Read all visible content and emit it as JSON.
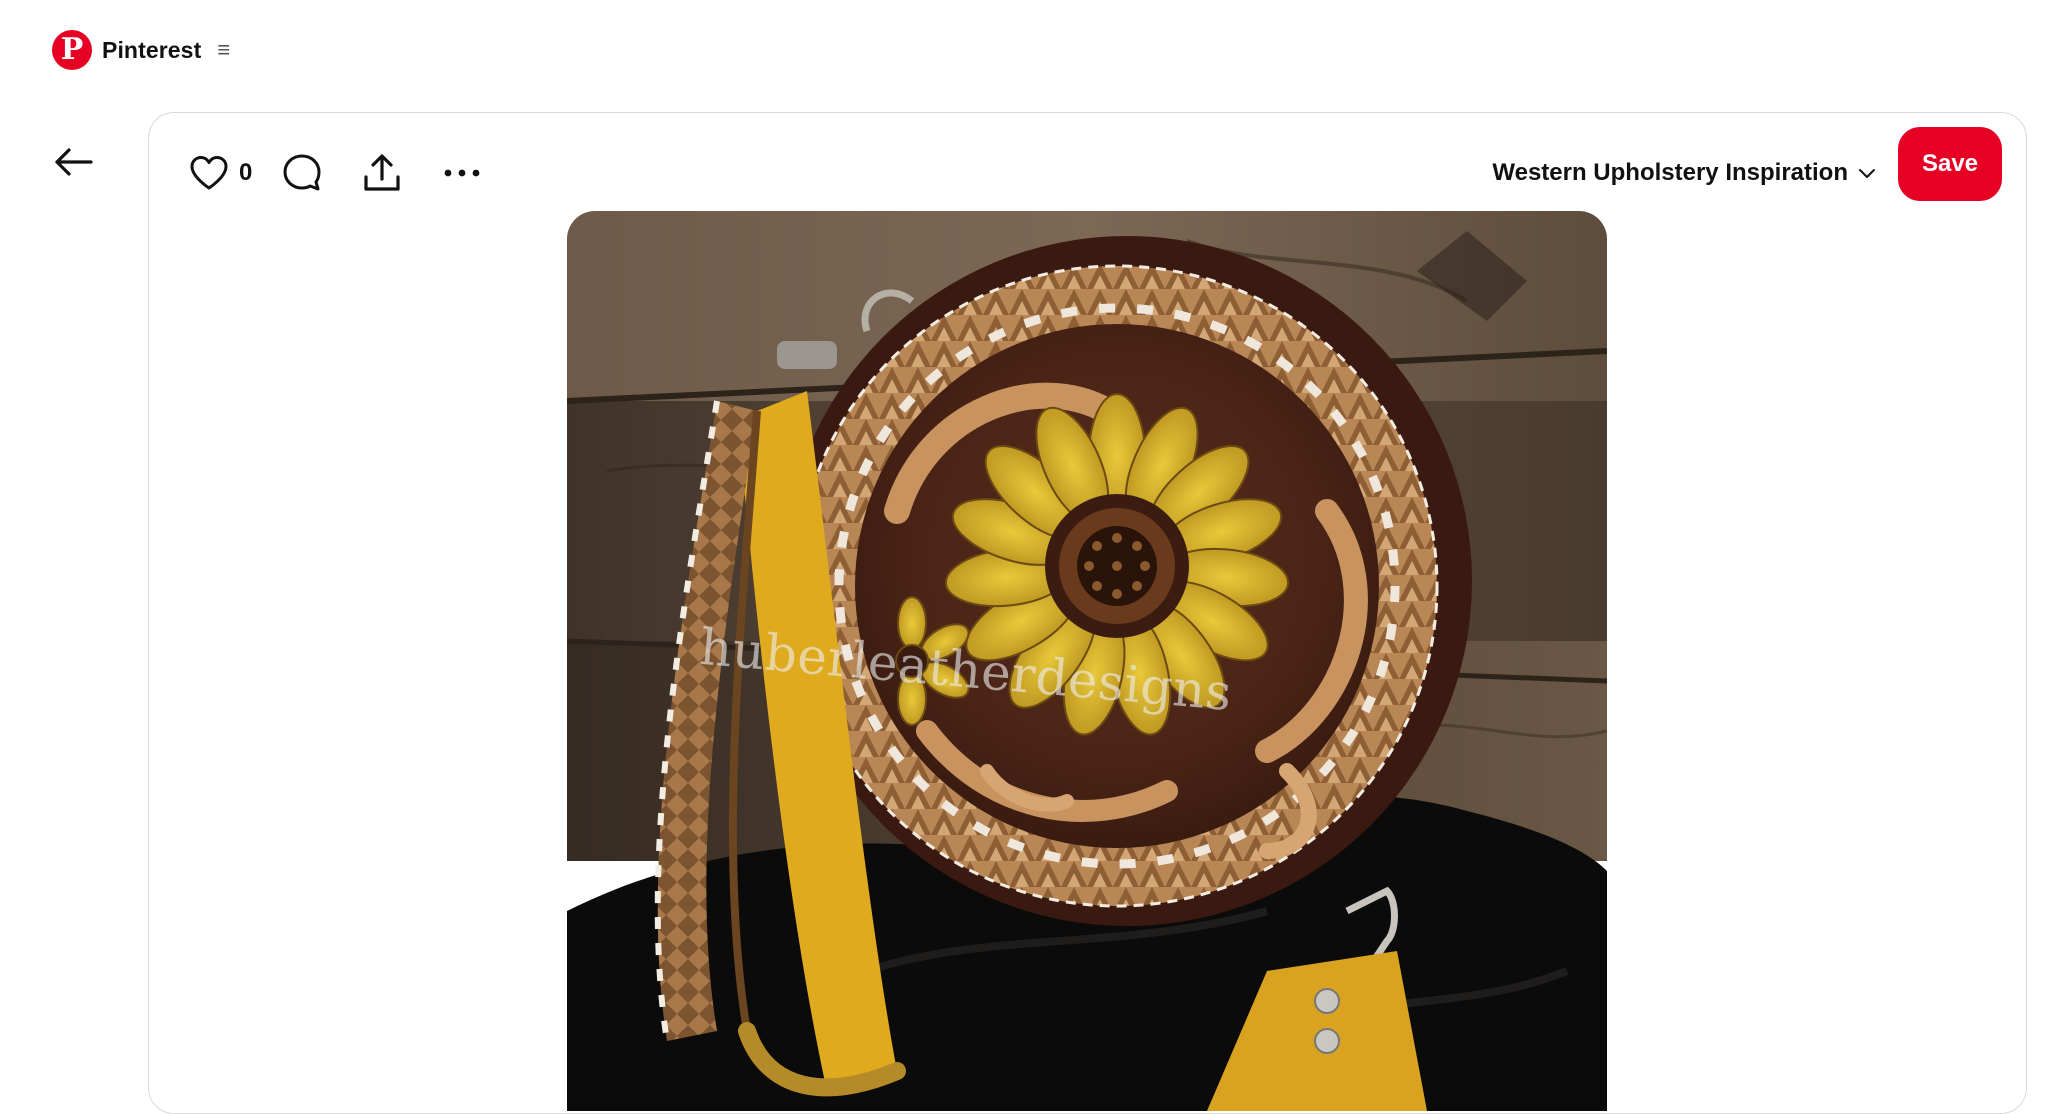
{
  "header": {
    "brand": "Pinterest",
    "logo_letter": "P",
    "menu_glyph": "≡"
  },
  "pin": {
    "like_count": "0",
    "board_name": "Western Upholstery Inspiration",
    "save_label": "Save",
    "watermark": "huberleatherdesigns"
  },
  "colors": {
    "brand": "#e60023",
    "text": "#111111",
    "card_border": "#d9d9d9"
  },
  "icons": [
    "back-arrow-icon",
    "heart-icon",
    "comment-icon",
    "share-icon",
    "more-icon",
    "chevron-down-icon",
    "menu-icon"
  ]
}
